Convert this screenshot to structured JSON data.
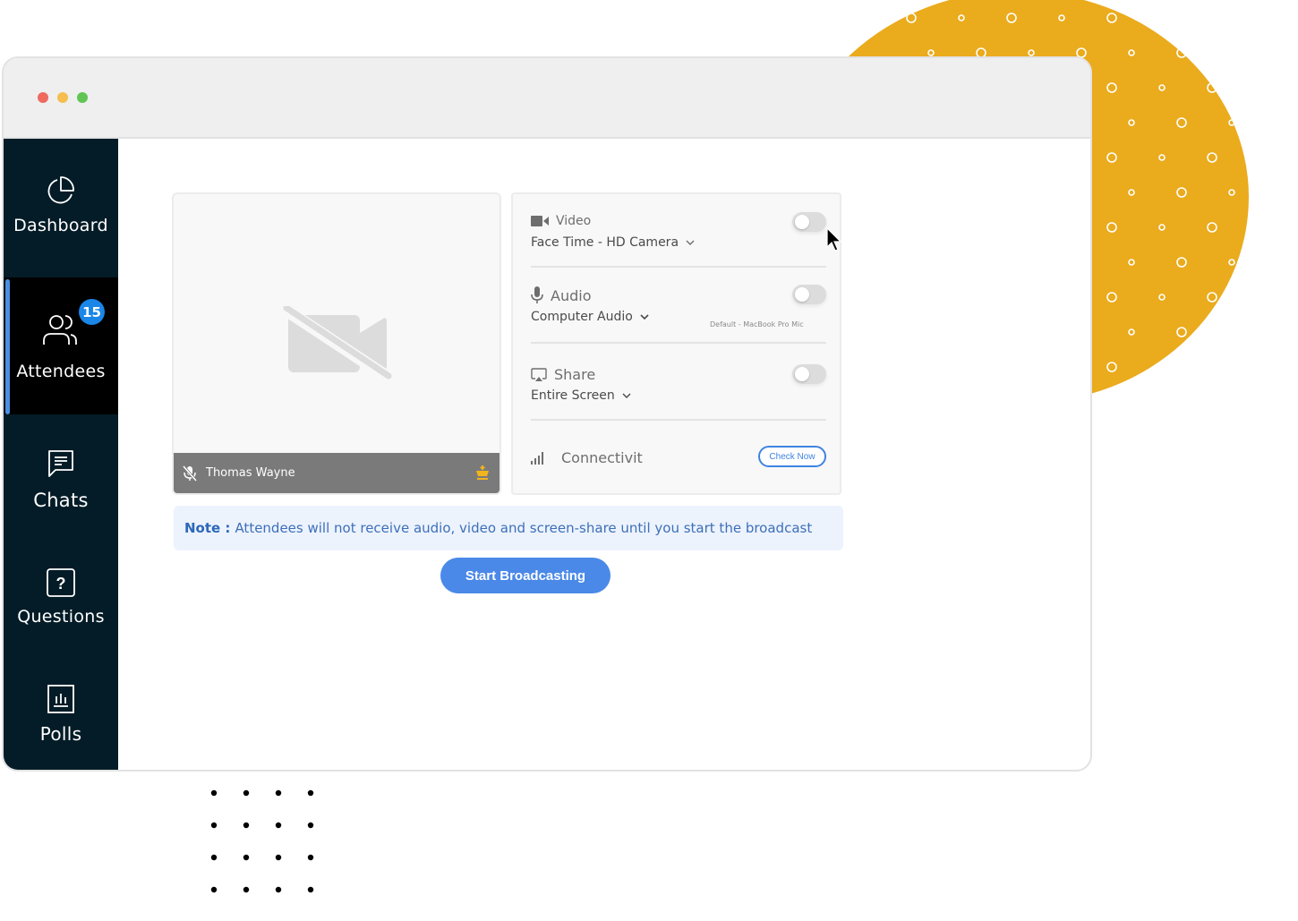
{
  "window": {
    "controls": [
      "close",
      "minimize",
      "maximize"
    ]
  },
  "sidebar": {
    "items": [
      {
        "label": "Dashboard",
        "icon": "pie-chart-icon",
        "active": false
      },
      {
        "label": "Attendees",
        "icon": "users-icon",
        "active": true,
        "badge": "15"
      },
      {
        "label": "Chats",
        "icon": "chat-icon",
        "active": false
      },
      {
        "label": "Questions",
        "icon": "question-icon",
        "active": false
      },
      {
        "label": "Polls",
        "icon": "poll-icon",
        "active": false
      }
    ]
  },
  "preview": {
    "camera_state": "off",
    "participant_name": "Thomas Wayne",
    "mic_state": "muted",
    "role_icon": "crown-icon"
  },
  "settings": {
    "video": {
      "title": "Video",
      "device": "Face Time - HD Camera",
      "enabled": false
    },
    "audio": {
      "title": "Audio",
      "device": "Computer Audio",
      "sub_device": "Default - MacBook Pro Mic",
      "enabled": false
    },
    "share": {
      "title": "Share",
      "source": "Entire Screen",
      "enabled": false
    },
    "connectivity": {
      "title": "Connectivit",
      "button": "Check Now"
    }
  },
  "note": {
    "label": "Note :",
    "text": "Attendees will not receive audio, video and screen-share until you start the broadcast"
  },
  "actions": {
    "start_broadcast": "Start Broadcasting"
  },
  "colors": {
    "accent": "#4a89e8",
    "sidebar_bg": "#041c27",
    "badge": "#1a86e8",
    "blob": "#eaab1d",
    "crown": "#f2b51d"
  }
}
